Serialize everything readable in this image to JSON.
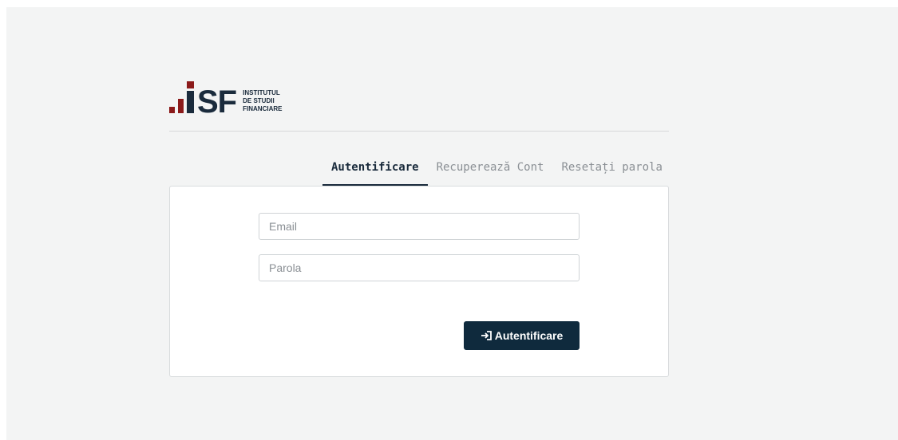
{
  "logo": {
    "mark": "SF",
    "line1": "INSTITUTUL",
    "line2": "DE STUDII",
    "line3": "FINANCIARE"
  },
  "tabs": [
    {
      "label": "Autentificare",
      "active": true
    },
    {
      "label": "Recuperează Cont",
      "active": false
    },
    {
      "label": "Resetați parola",
      "active": false
    }
  ],
  "form": {
    "email_placeholder": "Email",
    "password_placeholder": "Parola",
    "submit_label": "Autentificare",
    "submit_icon": "login-icon"
  },
  "colors": {
    "brand_dark": "#0f2a3d",
    "brand_red": "#8b1a1a",
    "page_bg": "#f3f4f4"
  }
}
